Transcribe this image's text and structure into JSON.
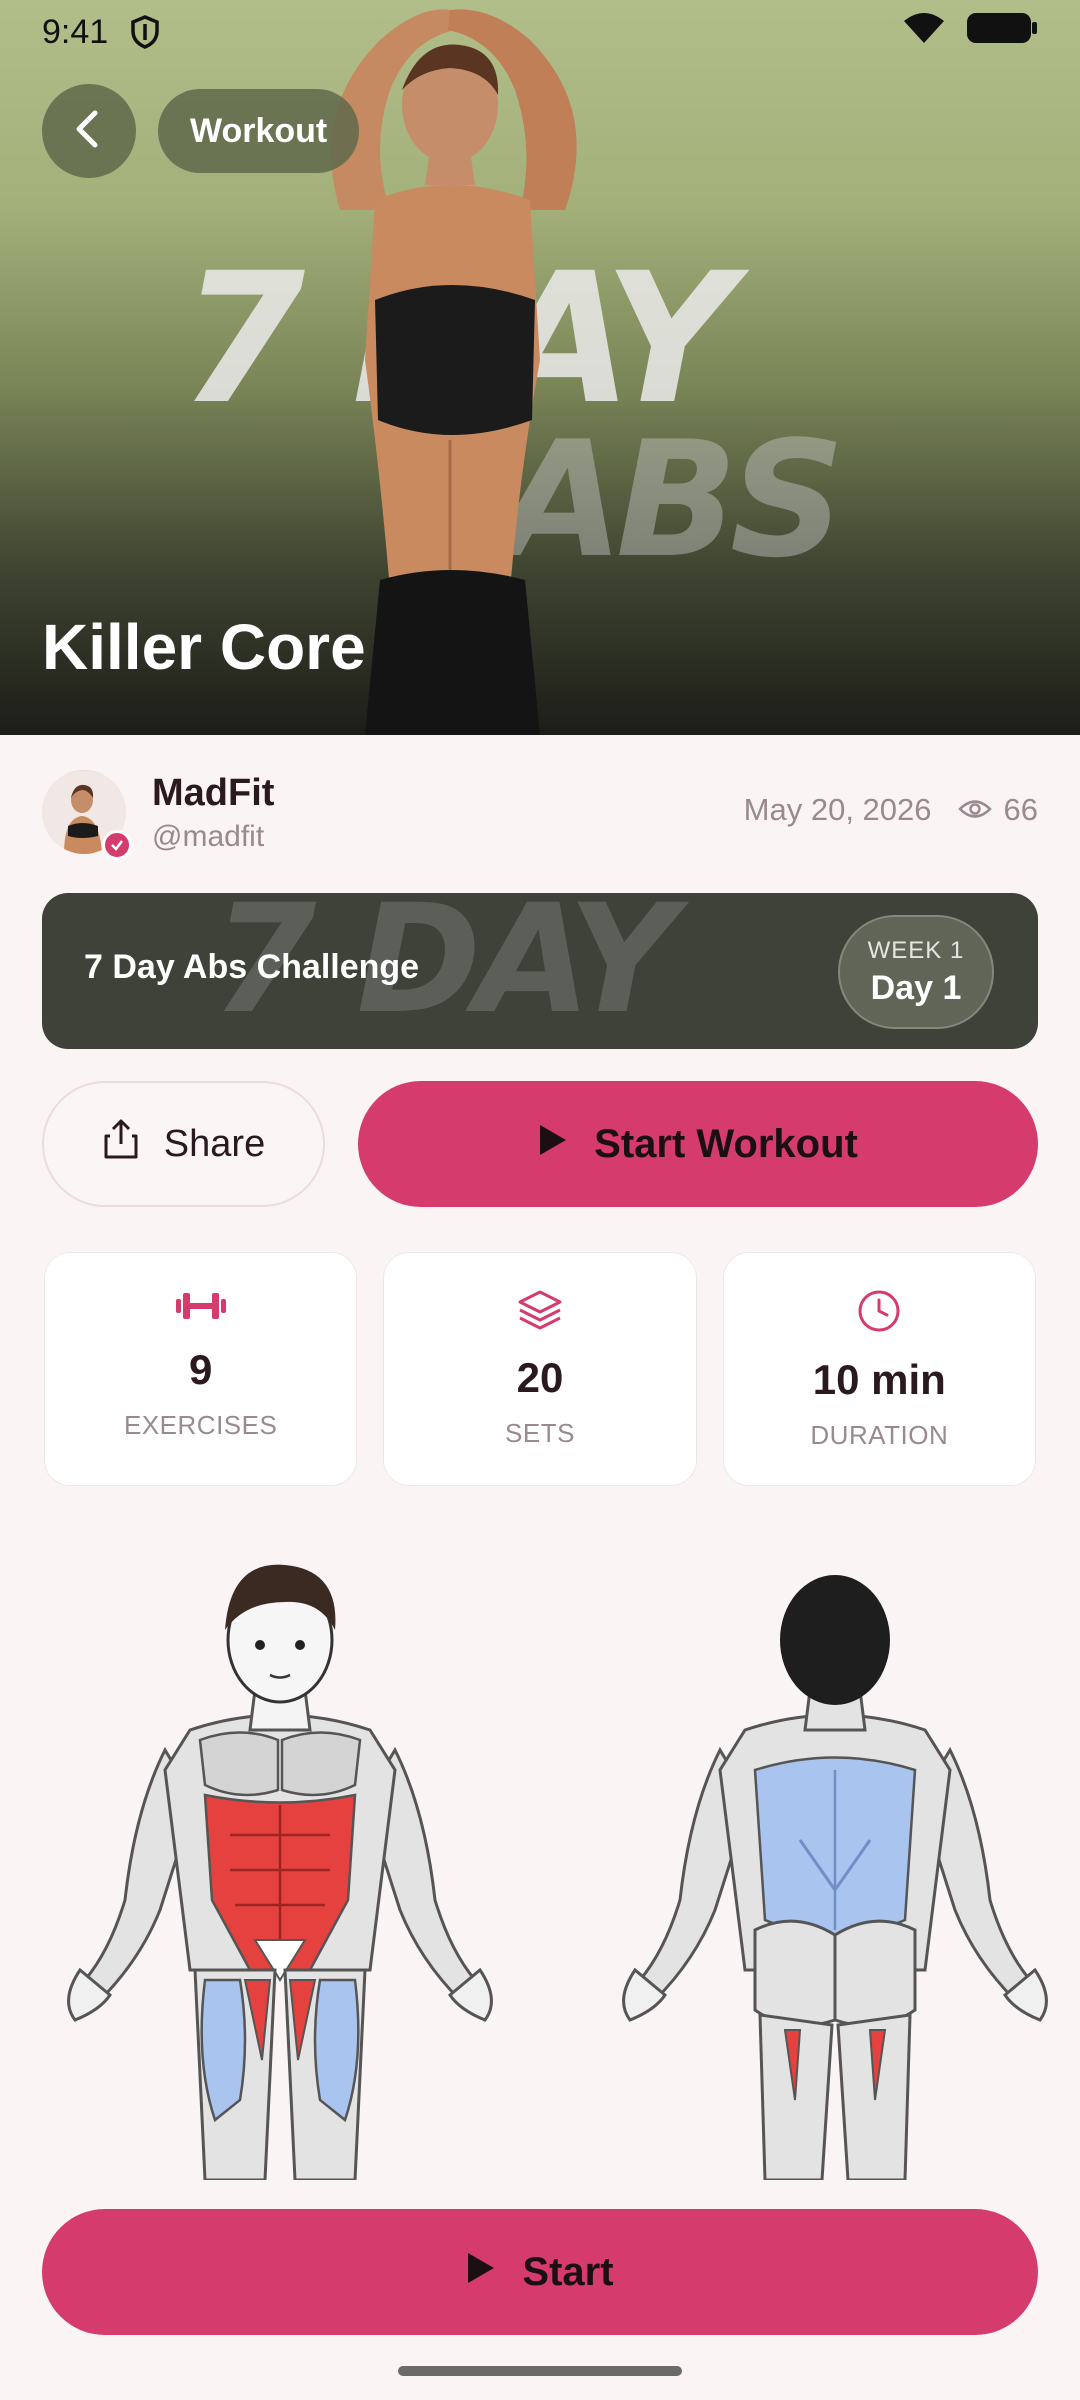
{
  "status_bar": {
    "time": "9:41"
  },
  "hero": {
    "back_icon": "chevron-left-icon",
    "breadcrumb": "Workout",
    "title": "Killer Core",
    "background_text_line1": "7 DAY",
    "background_text_line2": "ABS"
  },
  "author": {
    "name": "MadFit",
    "handle": "@madfit",
    "date": "May 20, 2026",
    "views": "66"
  },
  "challenge": {
    "title": "7 Day Abs Challenge",
    "week_label": "WEEK 1",
    "day_label": "Day 1",
    "background_text": "7 DAY"
  },
  "actions": {
    "share_label": "Share",
    "start_workout_label": "Start Workout"
  },
  "stats": [
    {
      "icon": "dumbbell-icon",
      "value": "9",
      "label": "EXERCISES"
    },
    {
      "icon": "layers-icon",
      "value": "20",
      "label": "SETS"
    },
    {
      "icon": "clock-icon",
      "value": "10 min",
      "label": "DURATION"
    }
  ],
  "bottom": {
    "start_label": "Start"
  },
  "colors": {
    "accent": "#d63b6e",
    "primary_muscle": "#e5423f",
    "secondary_muscle": "#a9c4ee"
  }
}
